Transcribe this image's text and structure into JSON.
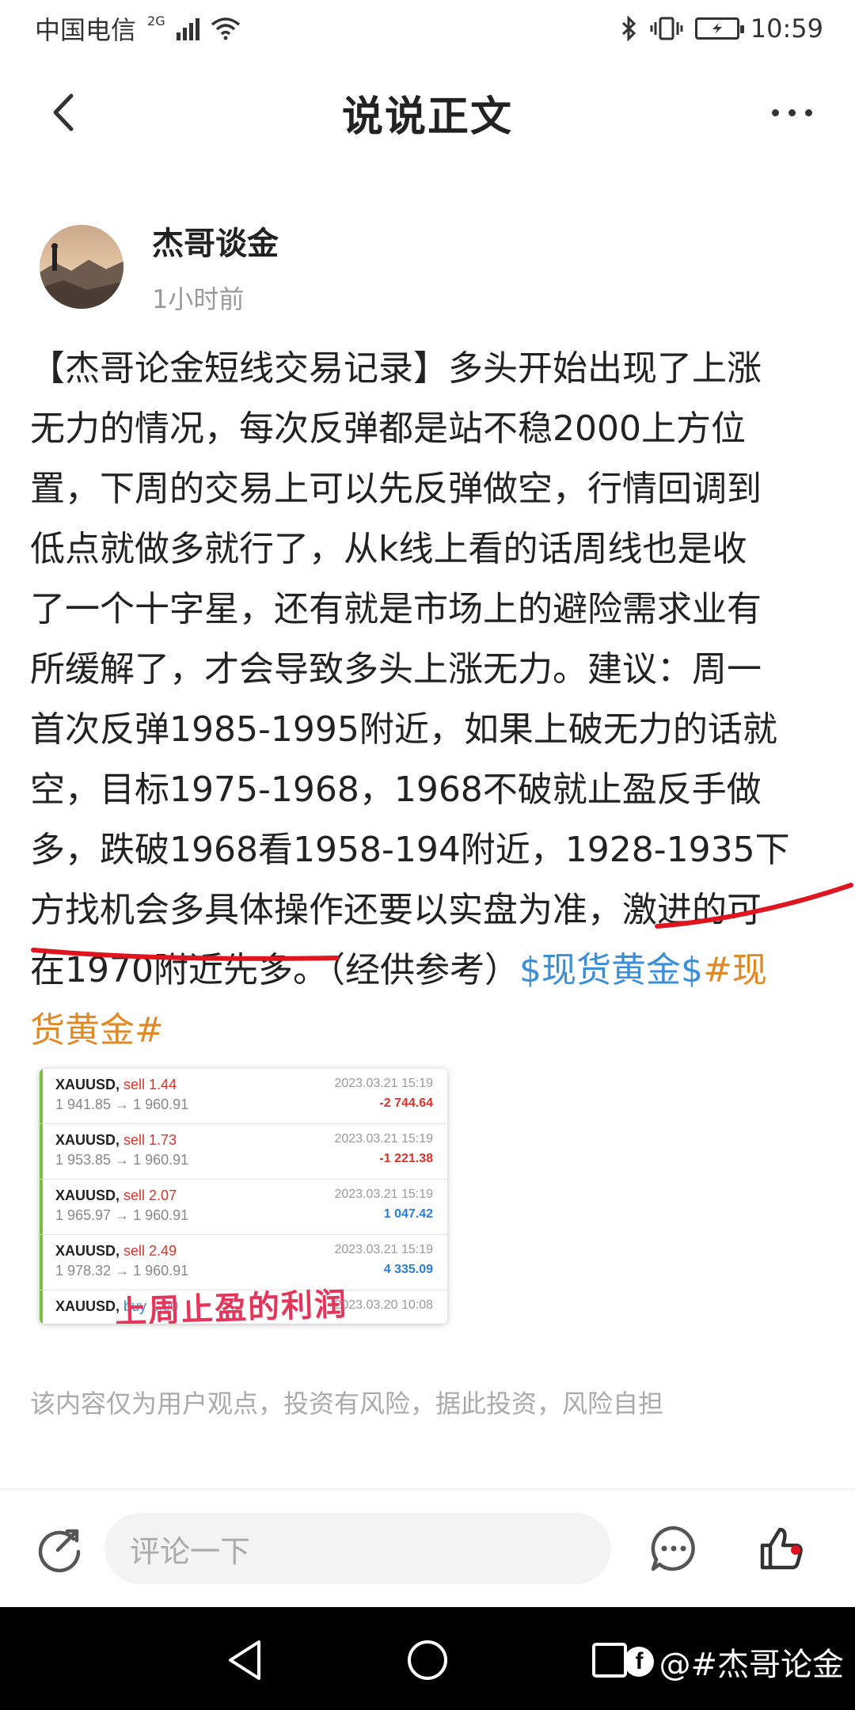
{
  "status_bar": {
    "carrier": "中国电信",
    "network": "2G",
    "time": "10:59"
  },
  "header": {
    "title": "说说正文"
  },
  "author": {
    "name": "杰哥谈金",
    "time": "1小时前"
  },
  "post": {
    "lines": [
      "【杰哥论金短线交易记录】多头开始出现了上涨",
      "无力的情况，每次反弹都是站不稳2000上方位",
      "置，下周的交易上可以先反弹做空，行情回调到",
      "低点就做多就行了，从k线上看的话周线也是收",
      "了一个十字星，还有就是市场上的避险需求业有",
      "所缓解了，才会导致多头上涨无力。建议：周一",
      "首次反弹1985-1995附近，如果上破无力的话就",
      "空，目标1975-1968，1968不破就止盈反手做",
      "多，跌破1968看1958-194附近，1928-1935下",
      "方找机会多具体操作还要以实盘为准，激进的可"
    ],
    "line11_plain": "在1970附近先多。（经供参考）",
    "tag_blue": "$现货黄金$",
    "tag_orange_part1": "#现",
    "tag_orange_part2": "货黄金#",
    "disclaimer": "该内容仅为用户观点，投资有风险，据此投资，风险自担"
  },
  "trades": [
    {
      "symbol": "XAUUSD,",
      "direction": "sell 1.44",
      "prices": "1 941.85 → 1 960.91",
      "date": "2023.03.21 15:19",
      "profit": "-2 744.64",
      "profit_type": "neg"
    },
    {
      "symbol": "XAUUSD,",
      "direction": "sell 1.73",
      "prices": "1 953.85 → 1 960.91",
      "date": "2023.03.21 15:19",
      "profit": "-1 221.38",
      "profit_type": "neg"
    },
    {
      "symbol": "XAUUSD,",
      "direction": "sell 2.07",
      "prices": "1 965.97 → 1 960.91",
      "date": "2023.03.21 15:19",
      "profit": "1 047.42",
      "profit_type": "pos"
    },
    {
      "symbol": "XAUUSD,",
      "direction": "sell 2.49",
      "prices": "1 978.32 → 1 960.91",
      "date": "2023.03.21 15:19",
      "profit": "4 335.09",
      "profit_type": "pos"
    },
    {
      "symbol": "XAUUSD,",
      "direction": "buy 1.00",
      "prices": "",
      "date": "2023.03.20 10:08",
      "profit": "",
      "profit_type": "pos"
    }
  ],
  "trade_overlay": "上周止盈的利润",
  "action_bar": {
    "comment_placeholder": "评论一下"
  },
  "watermark": "@#杰哥论金",
  "colors": {
    "tag_blue": "#3b8fd8",
    "tag_orange": "#e08a27",
    "underline_red": "#e0141e"
  }
}
